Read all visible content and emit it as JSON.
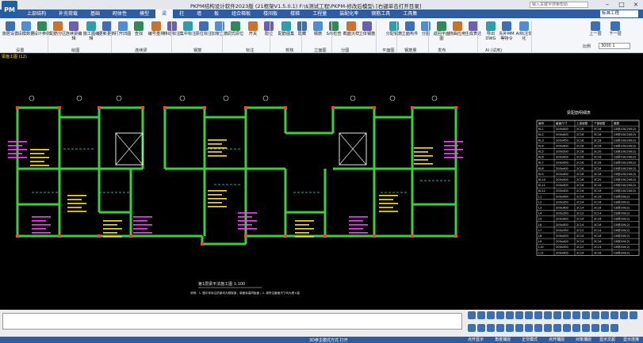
{
  "app": {
    "logo": "PM",
    "title": "PKPM结构设计软件2023版 (21框架V1.5.0.1) F:\\$测试工程\\PKPM-修改后模型\\ [右键单击打开目录]",
    "search_placeholder": "输入关键字搜索帮助"
  },
  "window_controls": {
    "minimize": "–",
    "maximize": "□",
    "close": "×"
  },
  "menu": {
    "tabs": [
      "上部结构",
      "补充荷载",
      "基础",
      "砌体性",
      "模型",
      "梁",
      "柱",
      "墙",
      "板",
      "组合梯板",
      "楼间板",
      "楼梯",
      "工程量",
      "装配化率",
      "钢筋工具",
      "工具集"
    ],
    "active_index": 5
  },
  "floor_select": "标准工程",
  "ribbon": {
    "buttons": [
      "旅居设置",
      "设模数据",
      "设计参数",
      "配筋分区",
      "连续梁编辑",
      "施工图编辑",
      "更新更新",
      "打开旧图",
      "查找",
      "编号重排",
      "移动标注",
      "集中标注",
      "原位标注",
      "加架立筋",
      "调式原位",
      "开关",
      "隐位",
      "配筋图集",
      "隐藏",
      "钢筋",
      "S/R检查",
      "截面大样",
      "立体钢筋",
      "分配钢筋",
      "立面构件",
      "分图",
      "返回平面图",
      "挠曲应用",
      "生成表达",
      "导出DWG",
      "先补MM等特令",
      "AI标注优化"
    ],
    "groups": [
      "设置",
      "绘图",
      "连续梁",
      "钢筋",
      "标注",
      "校核",
      "立面图",
      "分图",
      "平面图",
      "钢筋量",
      "发布",
      "AI (试用)"
    ],
    "nav": {
      "prev": "上一层",
      "next": "下一层",
      "scale_label": "比例",
      "scale_value": "3000 1"
    }
  },
  "canvas": {
    "view_label": "梁施工图 (12)",
    "drawing_title": "第1层梁平法施工图 1:100",
    "note": "说明：1. 图中未标注的梁均为框架梁，梁面标高同板面；2. 梁所注截面尺寸均为宽×高"
  },
  "beam_table": {
    "title": "梁配筋明细表",
    "headers": [
      "编号",
      "截面尺寸",
      "上部钢筋",
      "下部钢筋",
      "箍筋"
    ],
    "rows": [
      [
        "KL1",
        "200x400",
        "2C16",
        "3C16",
        "C8@100/200(2)"
      ],
      [
        "KL2",
        "200x400",
        "2C16",
        "3C18",
        "C8@100/200(2)"
      ],
      [
        "KL3",
        "200x450",
        "2C18",
        "3C18",
        "C8@100/200(2)"
      ],
      [
        "KL4",
        "200x400",
        "2C16",
        "3C16",
        "C8@100/200(2)"
      ],
      [
        "KL5",
        "200x500",
        "2C18",
        "3C20",
        "C8@100/200(2)"
      ],
      [
        "KL6",
        "200x400",
        "2C16",
        "3C16",
        "C8@100/200(2)"
      ],
      [
        "KL7",
        "200x450",
        "2C16",
        "3C18",
        "C8@100/200(2)"
      ],
      [
        "KL8",
        "200x400",
        "2C16",
        "2C16",
        "C8@100/200(2)"
      ],
      [
        "KL9",
        "200x400",
        "2C16",
        "3C16",
        "C8@100/200(2)"
      ],
      [
        "KL10",
        "200x500",
        "2C18",
        "3C20",
        "C8@100/200(2)"
      ],
      [
        "KL11",
        "200x400",
        "2C16",
        "3C16",
        "C8@100/200(2)"
      ],
      [
        "KL12",
        "200x400",
        "2C16",
        "3C18",
        "C8@100/200(2)"
      ],
      [
        "L1",
        "200x400",
        "2C14",
        "3C16",
        "C8@200(2)"
      ],
      [
        "L2",
        "200x350",
        "2C14",
        "2C16",
        "C8@200(2)"
      ],
      [
        "L3",
        "200x400",
        "2C14",
        "3C16",
        "C8@200(2)"
      ],
      [
        "L4",
        "200x350",
        "2C12",
        "2C14",
        "C8@200(2)"
      ],
      [
        "L5",
        "200x400",
        "2C14",
        "3C16",
        "C8@200(2)"
      ],
      [
        "L6",
        "200x400",
        "2C14",
        "3C16",
        "C8@200(2)"
      ],
      [
        "L7",
        "200x350",
        "2C12",
        "2C14",
        "C8@200(2)"
      ],
      [
        "L8",
        "200x400",
        "2C14",
        "3C16",
        "C8@200(2)"
      ],
      [
        "L9",
        "200x400",
        "2C14",
        "3C16",
        "C8@200(2)"
      ],
      [
        "L10",
        "200x350",
        "2C12",
        "2C14",
        "C8@200(2)"
      ],
      [
        "L11",
        "200x400",
        "2C14",
        "3C16",
        "C8@200(2)"
      ]
    ]
  },
  "status": {
    "mode": "3D参主模式方式    打开",
    "buttons": [
      "点开显示",
      "角度捕捉",
      "正交模式",
      "点开捕捉",
      "对象捕捉",
      "显示文超",
      "显示连接"
    ]
  }
}
